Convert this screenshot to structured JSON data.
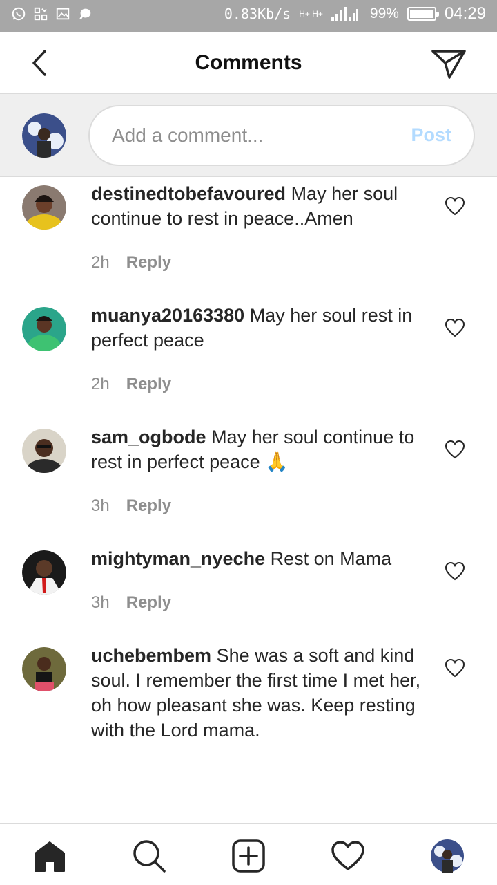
{
  "status_bar": {
    "net_speed": "0.83Kb/s",
    "signal_labels": "H+ H+",
    "battery_percent": "99%",
    "battery_level": 0.99,
    "time": "04:29"
  },
  "header": {
    "title": "Comments",
    "back_icon": "chevron-left-icon",
    "send_icon": "paper-plane-icon"
  },
  "composer": {
    "placeholder": "Add a comment...",
    "post_label": "Post",
    "post_color": "#b3dbff"
  },
  "comments": [
    {
      "username": "destinedtobefavoured",
      "text": "May her soul continue to rest in peace..Amen",
      "time": "2h",
      "reply_label": "Reply"
    },
    {
      "username": "muanya20163380",
      "text": "May her soul rest in perfect peace",
      "time": "2h",
      "reply_label": "Reply"
    },
    {
      "username": "sam_ogbode",
      "text": "May her soul continue to rest in perfect peace 🙏",
      "time": "3h",
      "reply_label": "Reply"
    },
    {
      "username": "mightyman_nyeche",
      "text": "Rest on Mama",
      "time": "3h",
      "reply_label": "Reply"
    },
    {
      "username": "uchebembem",
      "text": "She was a soft and kind soul. I remember the first time I met her, oh how pleasant she was. Keep resting with the Lord mama."
    }
  ],
  "bottom_nav": {
    "items": [
      "home-icon",
      "search-icon",
      "new-post-icon",
      "activity-heart-icon",
      "profile-avatar"
    ]
  },
  "colors": {
    "status_bar_bg": "#a7a7a7",
    "composer_bg": "#efefef",
    "text": "#262626",
    "meta": "#8e8e8e"
  }
}
